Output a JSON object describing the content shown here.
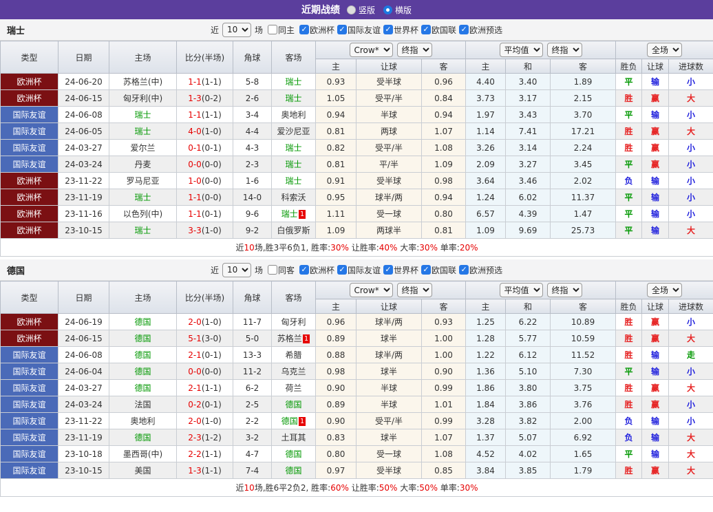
{
  "title_bar": {
    "title": "近期战绩",
    "options": [
      {
        "label": "竖版",
        "selected": false
      },
      {
        "label": "横版",
        "selected": true
      }
    ]
  },
  "columns": {
    "type": "类型",
    "date": "日期",
    "home": "主场",
    "score": "比分(半场)",
    "corner": "角球",
    "away": "客场",
    "sub": [
      "主",
      "让球",
      "客",
      "主",
      "和",
      "客",
      "胜负",
      "让球",
      "进球数"
    ]
  },
  "dropdowns": {
    "source": "Crow*",
    "final_a": "终指",
    "average": "平均值",
    "final_b": "终指",
    "scope": "全场"
  },
  "filter_labels": {
    "near": "近",
    "games": "场"
  },
  "colors": {
    "accent_purple": "#5b3e9d",
    "euro_badge": "#7b1013",
    "friendly_badge": "#4a6ab8",
    "win_red": "#e62222",
    "draw_green": "#009700",
    "lose_blue": "#2222dd",
    "score_red": "#e60000",
    "odds_bg": "#fbf6ec",
    "avg_bg": "#eef6fa"
  },
  "result_colors": {
    "胜": "red",
    "平": "green",
    "负": "blue",
    "赢": "red",
    "输": "blue",
    "大": "red",
    "小": "blue",
    "走": "green"
  },
  "sections": [
    {
      "team": "瑞士",
      "filter": {
        "recent_value": "10",
        "same_label": "同主",
        "same_checked": false,
        "leagues": [
          {
            "label": "欧洲杯",
            "checked": true
          },
          {
            "label": "国际友谊",
            "checked": true
          },
          {
            "label": "世界杯",
            "checked": true
          },
          {
            "label": "欧国联",
            "checked": true
          },
          {
            "label": "欧洲预选",
            "checked": true
          }
        ]
      },
      "rows": [
        {
          "league": "欧洲杯",
          "date": "24-06-20",
          "home": {
            "name": "苏格兰(中)",
            "self": false,
            "sup": ""
          },
          "score": "1-1",
          "half": "(1-1)",
          "corner": "5-8",
          "away": {
            "name": "瑞士",
            "self": true,
            "sup": ""
          },
          "o1": "0.93",
          "let": "受半球",
          "o2": "0.96",
          "a1": "4.40",
          "a2": "3.40",
          "a3": "1.89",
          "res": "平",
          "lr": "输",
          "goal": "小"
        },
        {
          "league": "欧洲杯",
          "date": "24-06-15",
          "home": {
            "name": "匈牙利(中)",
            "self": false,
            "sup": ""
          },
          "score": "1-3",
          "half": "(0-2)",
          "corner": "2-6",
          "away": {
            "name": "瑞士",
            "self": true,
            "sup": ""
          },
          "o1": "1.05",
          "let": "受平/半",
          "o2": "0.84",
          "a1": "3.73",
          "a2": "3.17",
          "a3": "2.15",
          "res": "胜",
          "lr": "赢",
          "goal": "大"
        },
        {
          "league": "国际友谊",
          "date": "24-06-08",
          "home": {
            "name": "瑞士",
            "self": true,
            "sup": ""
          },
          "score": "1-1",
          "half": "(1-1)",
          "corner": "3-4",
          "away": {
            "name": "奥地利",
            "self": false,
            "sup": ""
          },
          "o1": "0.94",
          "let": "半球",
          "o2": "0.94",
          "a1": "1.97",
          "a2": "3.43",
          "a3": "3.70",
          "res": "平",
          "lr": "输",
          "goal": "小"
        },
        {
          "league": "国际友谊",
          "date": "24-06-05",
          "home": {
            "name": "瑞士",
            "self": true,
            "sup": ""
          },
          "score": "4-0",
          "half": "(1-0)",
          "corner": "4-4",
          "away": {
            "name": "爱沙尼亚",
            "self": false,
            "sup": ""
          },
          "o1": "0.81",
          "let": "两球",
          "o2": "1.07",
          "a1": "1.14",
          "a2": "7.41",
          "a3": "17.21",
          "res": "胜",
          "lr": "赢",
          "goal": "大"
        },
        {
          "league": "国际友谊",
          "date": "24-03-27",
          "home": {
            "name": "爱尔兰",
            "self": false,
            "sup": ""
          },
          "score": "0-1",
          "half": "(0-1)",
          "corner": "4-3",
          "away": {
            "name": "瑞士",
            "self": true,
            "sup": ""
          },
          "o1": "0.82",
          "let": "受平/半",
          "o2": "1.08",
          "a1": "3.26",
          "a2": "3.14",
          "a3": "2.24",
          "res": "胜",
          "lr": "赢",
          "goal": "小"
        },
        {
          "league": "国际友谊",
          "date": "24-03-24",
          "home": {
            "name": "丹麦",
            "self": false,
            "sup": ""
          },
          "score": "0-0",
          "half": "(0-0)",
          "corner": "2-3",
          "away": {
            "name": "瑞士",
            "self": true,
            "sup": ""
          },
          "o1": "0.81",
          "let": "平/半",
          "o2": "1.09",
          "a1": "2.09",
          "a2": "3.27",
          "a3": "3.45",
          "res": "平",
          "lr": "赢",
          "goal": "小"
        },
        {
          "league": "欧洲杯",
          "date": "23-11-22",
          "home": {
            "name": "罗马尼亚",
            "self": false,
            "sup": ""
          },
          "score": "1-0",
          "half": "(0-0)",
          "corner": "1-6",
          "away": {
            "name": "瑞士",
            "self": true,
            "sup": ""
          },
          "o1": "0.91",
          "let": "受半球",
          "o2": "0.98",
          "a1": "3.64",
          "a2": "3.46",
          "a3": "2.02",
          "res": "负",
          "lr": "输",
          "goal": "小"
        },
        {
          "league": "欧洲杯",
          "date": "23-11-19",
          "home": {
            "name": "瑞士",
            "self": true,
            "sup": ""
          },
          "score": "1-1",
          "half": "(0-0)",
          "corner": "14-0",
          "away": {
            "name": "科索沃",
            "self": false,
            "sup": ""
          },
          "o1": "0.95",
          "let": "球半/两",
          "o2": "0.94",
          "a1": "1.24",
          "a2": "6.02",
          "a3": "11.37",
          "res": "平",
          "lr": "输",
          "goal": "小"
        },
        {
          "league": "欧洲杯",
          "date": "23-11-16",
          "home": {
            "name": "以色列(中)",
            "self": false,
            "sup": ""
          },
          "score": "1-1",
          "half": "(0-1)",
          "corner": "9-6",
          "away": {
            "name": "瑞士",
            "self": true,
            "sup": "1"
          },
          "o1": "1.11",
          "let": "受一球",
          "o2": "0.80",
          "a1": "6.57",
          "a2": "4.39",
          "a3": "1.47",
          "res": "平",
          "lr": "输",
          "goal": "小"
        },
        {
          "league": "欧洲杯",
          "date": "23-10-15",
          "home": {
            "name": "瑞士",
            "self": true,
            "sup": ""
          },
          "score": "3-3",
          "half": "(1-0)",
          "corner": "9-2",
          "away": {
            "name": "白俄罗斯",
            "self": false,
            "sup": ""
          },
          "o1": "1.09",
          "let": "两球半",
          "o2": "0.81",
          "a1": "1.09",
          "a2": "9.69",
          "a3": "25.73",
          "res": "平",
          "lr": "输",
          "goal": "大"
        }
      ],
      "summary": [
        [
          "近",
          false
        ],
        [
          "10",
          true
        ],
        [
          "场,胜3平6负1, 胜率:",
          false
        ],
        [
          "30%",
          true
        ],
        [
          " 让胜率:",
          false
        ],
        [
          "40%",
          true
        ],
        [
          " 大率:",
          false
        ],
        [
          "30%",
          true
        ],
        [
          " 单率:",
          false
        ],
        [
          "20%",
          true
        ]
      ]
    },
    {
      "team": "德国",
      "filter": {
        "recent_value": "10",
        "same_label": "同客",
        "same_checked": false,
        "leagues": [
          {
            "label": "欧洲杯",
            "checked": true
          },
          {
            "label": "国际友谊",
            "checked": true
          },
          {
            "label": "世界杯",
            "checked": true
          },
          {
            "label": "欧国联",
            "checked": true
          },
          {
            "label": "欧洲预选",
            "checked": true
          }
        ]
      },
      "rows": [
        {
          "league": "欧洲杯",
          "date": "24-06-19",
          "home": {
            "name": "德国",
            "self": true,
            "sup": ""
          },
          "score": "2-0",
          "half": "(1-0)",
          "corner": "11-7",
          "away": {
            "name": "匈牙利",
            "self": false,
            "sup": ""
          },
          "o1": "0.96",
          "let": "球半/两",
          "o2": "0.93",
          "a1": "1.25",
          "a2": "6.22",
          "a3": "10.89",
          "res": "胜",
          "lr": "赢",
          "goal": "小"
        },
        {
          "league": "欧洲杯",
          "date": "24-06-15",
          "home": {
            "name": "德国",
            "self": true,
            "sup": ""
          },
          "score": "5-1",
          "half": "(3-0)",
          "corner": "5-0",
          "away": {
            "name": "苏格兰",
            "self": false,
            "sup": "1"
          },
          "o1": "0.89",
          "let": "球半",
          "o2": "1.00",
          "a1": "1.28",
          "a2": "5.77",
          "a3": "10.59",
          "res": "胜",
          "lr": "赢",
          "goal": "大"
        },
        {
          "league": "国际友谊",
          "date": "24-06-08",
          "home": {
            "name": "德国",
            "self": true,
            "sup": ""
          },
          "score": "2-1",
          "half": "(0-1)",
          "corner": "13-3",
          "away": {
            "name": "希腊",
            "self": false,
            "sup": ""
          },
          "o1": "0.88",
          "let": "球半/两",
          "o2": "1.00",
          "a1": "1.22",
          "a2": "6.12",
          "a3": "11.52",
          "res": "胜",
          "lr": "输",
          "goal": "走"
        },
        {
          "league": "国际友谊",
          "date": "24-06-04",
          "home": {
            "name": "德国",
            "self": true,
            "sup": ""
          },
          "score": "0-0",
          "half": "(0-0)",
          "corner": "11-2",
          "away": {
            "name": "乌克兰",
            "self": false,
            "sup": ""
          },
          "o1": "0.98",
          "let": "球半",
          "o2": "0.90",
          "a1": "1.36",
          "a2": "5.10",
          "a3": "7.30",
          "res": "平",
          "lr": "输",
          "goal": "小"
        },
        {
          "league": "国际友谊",
          "date": "24-03-27",
          "home": {
            "name": "德国",
            "self": true,
            "sup": ""
          },
          "score": "2-1",
          "half": "(1-1)",
          "corner": "6-2",
          "away": {
            "name": "荷兰",
            "self": false,
            "sup": ""
          },
          "o1": "0.90",
          "let": "半球",
          "o2": "0.99",
          "a1": "1.86",
          "a2": "3.80",
          "a3": "3.75",
          "res": "胜",
          "lr": "赢",
          "goal": "大"
        },
        {
          "league": "国际友谊",
          "date": "24-03-24",
          "home": {
            "name": "法国",
            "self": false,
            "sup": ""
          },
          "score": "0-2",
          "half": "(0-1)",
          "corner": "2-5",
          "away": {
            "name": "德国",
            "self": true,
            "sup": ""
          },
          "o1": "0.89",
          "let": "半球",
          "o2": "1.01",
          "a1": "1.84",
          "a2": "3.86",
          "a3": "3.76",
          "res": "胜",
          "lr": "赢",
          "goal": "小"
        },
        {
          "league": "国际友谊",
          "date": "23-11-22",
          "home": {
            "name": "奥地利",
            "self": false,
            "sup": ""
          },
          "score": "2-0",
          "half": "(1-0)",
          "corner": "2-2",
          "away": {
            "name": "德国",
            "self": true,
            "sup": "1"
          },
          "o1": "0.90",
          "let": "受平/半",
          "o2": "0.99",
          "a1": "3.28",
          "a2": "3.82",
          "a3": "2.00",
          "res": "负",
          "lr": "输",
          "goal": "小"
        },
        {
          "league": "国际友谊",
          "date": "23-11-19",
          "home": {
            "name": "德国",
            "self": true,
            "sup": ""
          },
          "score": "2-3",
          "half": "(1-2)",
          "corner": "3-2",
          "away": {
            "name": "土耳其",
            "self": false,
            "sup": ""
          },
          "o1": "0.83",
          "let": "球半",
          "o2": "1.07",
          "a1": "1.37",
          "a2": "5.07",
          "a3": "6.92",
          "res": "负",
          "lr": "输",
          "goal": "大"
        },
        {
          "league": "国际友谊",
          "date": "23-10-18",
          "home": {
            "name": "墨西哥(中)",
            "self": false,
            "sup": ""
          },
          "score": "2-2",
          "half": "(1-1)",
          "corner": "4-7",
          "away": {
            "name": "德国",
            "self": true,
            "sup": ""
          },
          "o1": "0.80",
          "let": "受一球",
          "o2": "1.08",
          "a1": "4.52",
          "a2": "4.02",
          "a3": "1.65",
          "res": "平",
          "lr": "输",
          "goal": "大"
        },
        {
          "league": "国际友谊",
          "date": "23-10-15",
          "home": {
            "name": "美国",
            "self": false,
            "sup": ""
          },
          "score": "1-3",
          "half": "(1-1)",
          "corner": "7-4",
          "away": {
            "name": "德国",
            "self": true,
            "sup": ""
          },
          "o1": "0.97",
          "let": "受半球",
          "o2": "0.85",
          "a1": "3.84",
          "a2": "3.85",
          "a3": "1.79",
          "res": "胜",
          "lr": "赢",
          "goal": "大"
        }
      ],
      "summary": [
        [
          "近",
          false
        ],
        [
          "10",
          true
        ],
        [
          "场,胜6平2负2, 胜率:",
          false
        ],
        [
          "60%",
          true
        ],
        [
          " 让胜率:",
          false
        ],
        [
          "50%",
          true
        ],
        [
          " 大率:",
          false
        ],
        [
          "50%",
          true
        ],
        [
          " 单率:",
          false
        ],
        [
          "30%",
          true
        ]
      ]
    }
  ]
}
